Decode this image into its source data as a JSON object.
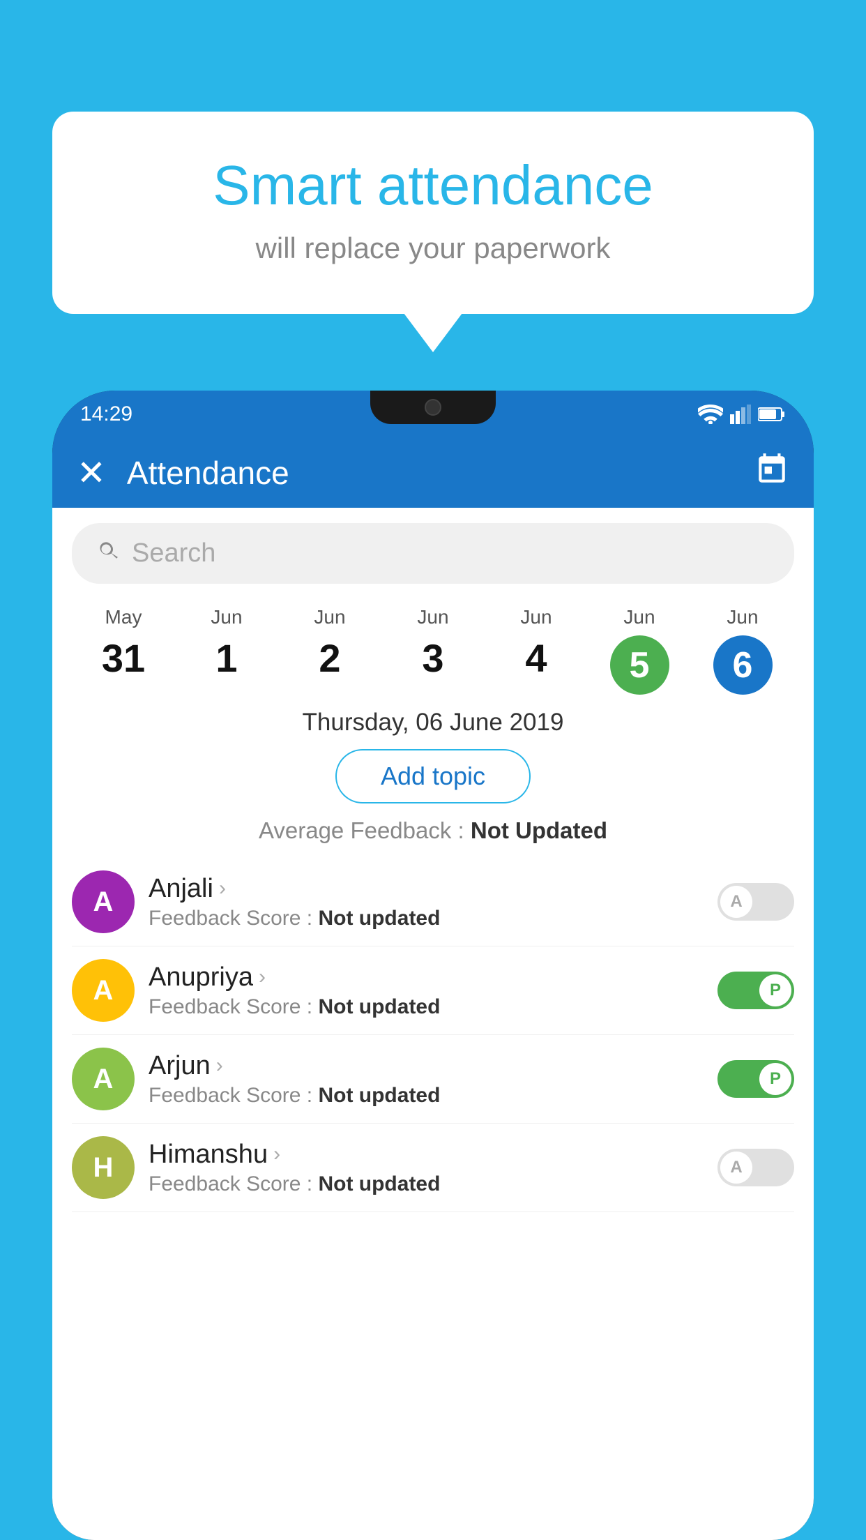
{
  "background_color": "#29b6e8",
  "bubble": {
    "title": "Smart attendance",
    "subtitle": "will replace your paperwork"
  },
  "status_bar": {
    "time": "14:29"
  },
  "app_bar": {
    "title": "Attendance"
  },
  "search": {
    "placeholder": "Search"
  },
  "dates": [
    {
      "month": "May",
      "day": "31",
      "type": "normal"
    },
    {
      "month": "Jun",
      "day": "1",
      "type": "normal"
    },
    {
      "month": "Jun",
      "day": "2",
      "type": "normal"
    },
    {
      "month": "Jun",
      "day": "3",
      "type": "normal"
    },
    {
      "month": "Jun",
      "day": "4",
      "type": "normal"
    },
    {
      "month": "Jun",
      "day": "5",
      "type": "green"
    },
    {
      "month": "Jun",
      "day": "6",
      "type": "blue"
    }
  ],
  "selected_date": "Thursday, 06 June 2019",
  "add_topic_label": "Add topic",
  "avg_feedback": {
    "label": "Average Feedback : ",
    "value": "Not Updated"
  },
  "students": [
    {
      "name": "Anjali",
      "avatar_letter": "A",
      "avatar_color": "purple",
      "feedback_label": "Feedback Score : ",
      "feedback_value": "Not updated",
      "toggle": "off",
      "toggle_letter": "A"
    },
    {
      "name": "Anupriya",
      "avatar_letter": "A",
      "avatar_color": "yellow",
      "feedback_label": "Feedback Score : ",
      "feedback_value": "Not updated",
      "toggle": "on",
      "toggle_letter": "P"
    },
    {
      "name": "Arjun",
      "avatar_letter": "A",
      "avatar_color": "green",
      "feedback_label": "Feedback Score : ",
      "feedback_value": "Not updated",
      "toggle": "on",
      "toggle_letter": "P"
    },
    {
      "name": "Himanshu",
      "avatar_letter": "H",
      "avatar_color": "olive",
      "feedback_label": "Feedback Score : ",
      "feedback_value": "Not updated",
      "toggle": "off",
      "toggle_letter": "A"
    }
  ]
}
